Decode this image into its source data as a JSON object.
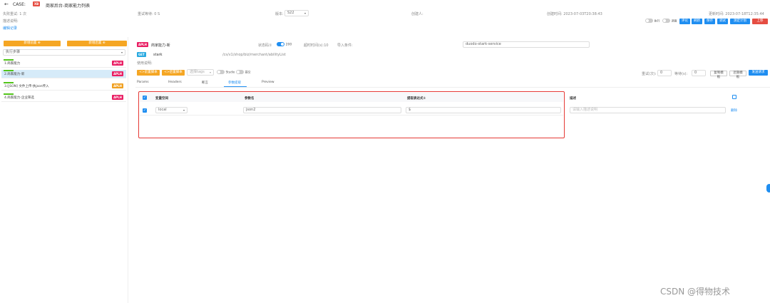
{
  "header": {
    "back_icon": "arrow-left-icon",
    "case_label": "CASE:",
    "case_tag": "XB",
    "title": "商家后台-商家能力列表",
    "fail_count": "失败重试: 1    次",
    "retry_wait": "重试等待: 0    S",
    "version_label": "版本:",
    "version_value": "S22",
    "creator": "创建人:",
    "created": "创建时间: 2023-07-03T20:38:43",
    "updated": "更新时间: 2023-07-18T12:35:44",
    "desc_label": "描述说明:",
    "record_link": "编辑记录"
  },
  "actions": {
    "toggle1": "执行",
    "toggle2": "调度",
    "buttons": [
      "评论",
      "刷新",
      "保存",
      "调试",
      "测定计划",
      "上移"
    ]
  },
  "sidebar": {
    "btn_left": "新增前置 ⊕",
    "btn_right": "新增后置 ⊕",
    "select_value": "执行步骤",
    "items": [
      {
        "label": "1.商家能力",
        "badge": "APLH",
        "orange": false,
        "selected": false
      },
      {
        "label": "2.商家能力-新",
        "badge": "APLH",
        "orange": false,
        "selected": true
      },
      {
        "label": "3.[JSON] 文件上传-执json传入",
        "badge": "APLH",
        "orange": true,
        "selected": false
      },
      {
        "label": "4.商家能力-企业筛选",
        "badge": "APLH",
        "orange": false,
        "selected": false
      }
    ]
  },
  "step": {
    "badge": "APLH",
    "name": "商家能力-新",
    "status_label": "状态码①",
    "status_value": "200",
    "timeout": "超时时间(s):10",
    "import_label": "导入条件:",
    "service": "duodo-stark-service",
    "method": "GET",
    "host": "stark",
    "path": "/cs/v1/shop/biz/merchant/abilityList",
    "usage_label": "使用说明:",
    "pre_btn": "<>前置脚本 ⊕",
    "post_btn": "<>后置脚本 ⊕",
    "select_placeholder": "选择tags",
    "toggle_label": "Studio",
    "toggle2_label": "提交",
    "retry_label": "重试(次):",
    "retry_value": "0",
    "wait_label": "等待(s):",
    "wait_value": "0",
    "copy_btn": "复制模板",
    "recent_btn": "近期模板",
    "send_btn": "发送请求"
  },
  "tabs": [
    "Params",
    "Headers",
    "断言",
    "参数提取",
    "Preview"
  ],
  "table": {
    "headers": [
      "变量空间",
      "参数名",
      "提取表达式①",
      "描述"
    ],
    "row": {
      "scope": "local",
      "name": "json2",
      "expr": "$",
      "desc_placeholder": "请输入描述说明",
      "delete": "删除"
    }
  },
  "watermark": "CSDN @得物技术"
}
